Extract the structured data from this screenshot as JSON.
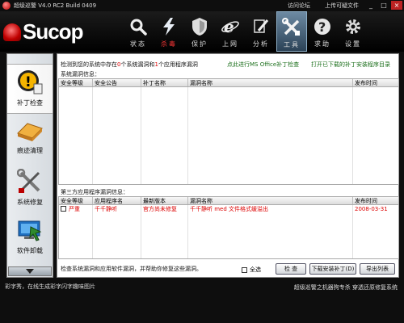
{
  "titlebar": {
    "title": "超级巡警 V4.0 RC2 Build 0409",
    "links": [
      "访问论坛",
      "上传可疑文件"
    ],
    "buttons": [
      "_",
      "□",
      "×"
    ]
  },
  "header": {
    "logo_text": "Sucop",
    "nav": [
      {
        "label": "状态",
        "icon": "magnifier-icon"
      },
      {
        "label": "杀毒",
        "icon": "lightning-icon"
      },
      {
        "label": "保护",
        "icon": "shield-icon"
      },
      {
        "label": "上网",
        "icon": "ie-icon"
      },
      {
        "label": "分析",
        "icon": "pen-icon"
      },
      {
        "label": "工具",
        "icon": "tools-icon"
      },
      {
        "label": "求助",
        "icon": "help-icon"
      },
      {
        "label": "设置",
        "icon": "gear-icon"
      }
    ]
  },
  "sidebar": {
    "items": [
      {
        "label": "补丁检查",
        "icon": "patch-warning-icon"
      },
      {
        "label": "痕迹清理",
        "icon": "eraser-icon"
      },
      {
        "label": "系统修复",
        "icon": "wrench-screwdriver-icon"
      },
      {
        "label": "软件卸载",
        "icon": "uninstall-icon"
      }
    ]
  },
  "main": {
    "summary_pre": "检测到您的系统中存在",
    "sys_count": "0",
    "summary_mid": "个系统漏洞和",
    "app_count": "1",
    "summary_post": "个应用程序漏洞",
    "link_office": "点此进行MS Office补丁检查",
    "link_dir": "打开已下载的补丁安装程序目录",
    "sys_section_label": "系统漏洞信息：",
    "sys_columns": [
      "安全等级",
      "安全公告",
      "补丁名称",
      "漏洞名称",
      "发布时间"
    ],
    "app_section_label": "第三方应用程序漏洞信息：",
    "app_columns": [
      "安全等级",
      "应用程序名",
      "最新版本",
      "漏洞名称",
      "发布时间"
    ],
    "app_rows": [
      {
        "level": "严重",
        "app": "千千静听",
        "version": "官方尚未修复",
        "vuln": "千千静听 med 文件格式缓溢出",
        "date": "2008-03-31"
      }
    ],
    "bottom_text": "检查系统漏洞和应用软件漏洞，并帮助你修复这些漏洞。",
    "select_all": "全选",
    "btn_check": "检 查",
    "btn_download": "下载安装补丁(D)",
    "btn_export": "导出列表"
  },
  "statusbar": {
    "left": "彩字秀，在线生成彩字闪字趣味图片",
    "right": "超级巡警之机器狗专杀  穿透还原修复系统"
  },
  "colors": {
    "accent_red": "#d00000",
    "link_green": "#1a6e1a",
    "header_bg": "#000000",
    "active_tab": "#4a6a86"
  }
}
